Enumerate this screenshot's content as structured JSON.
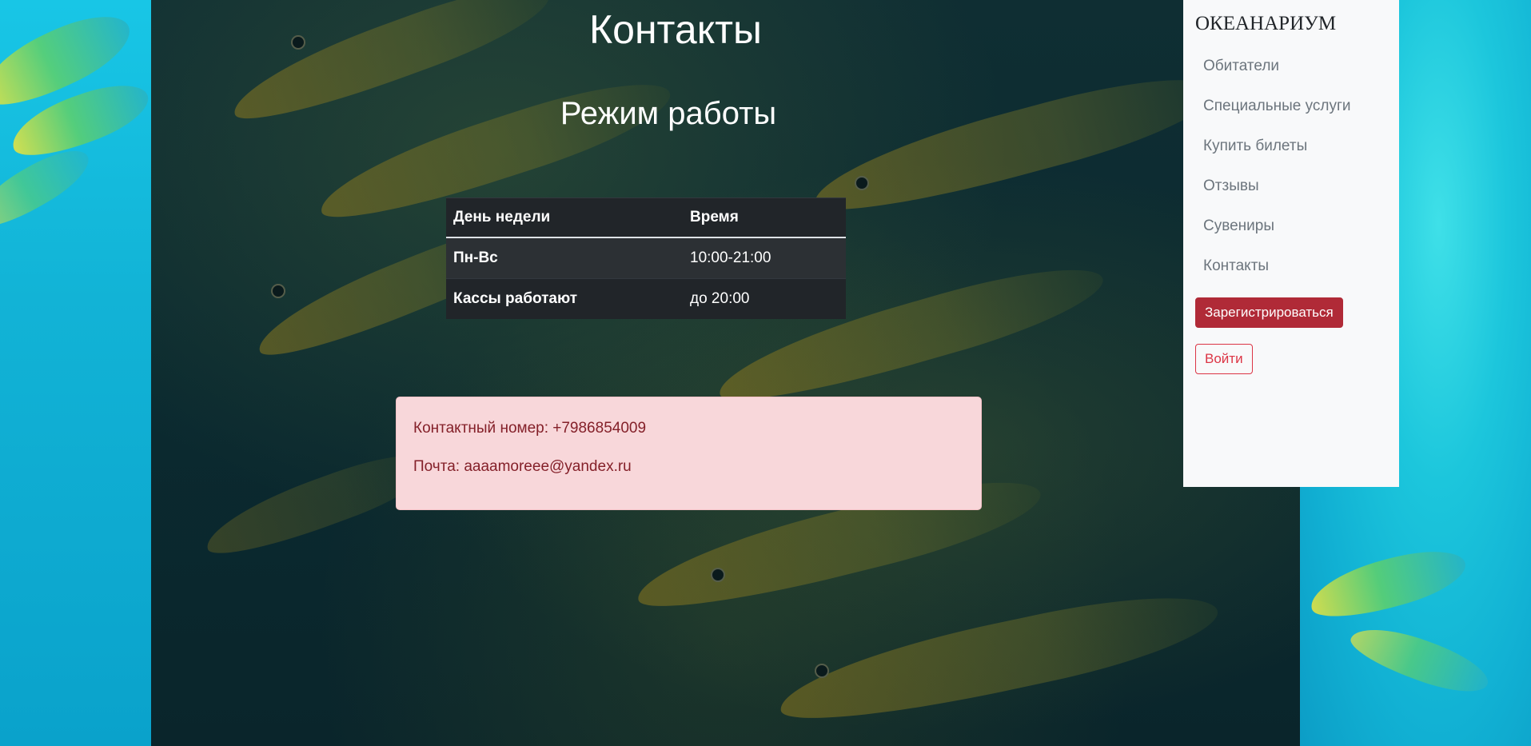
{
  "header": {
    "title": "Контакты",
    "section_title": "Режим работы"
  },
  "schedule": {
    "columns": [
      "День недели",
      "Время"
    ],
    "rows": [
      {
        "day": "Пн-Вс",
        "time": "10:00-21:00"
      },
      {
        "day": "Кассы работают",
        "time": "до 20:00"
      }
    ]
  },
  "contact": {
    "phone": "Контактный номер: +7986854009",
    "email": "Почта: aaaamoreee@yandex.ru",
    "colors": {
      "background": "#f8d7da",
      "text": "#842029"
    }
  },
  "sidebar": {
    "brand": "ОКЕАНАРИУМ",
    "items": [
      {
        "label": "Обитатели"
      },
      {
        "label": "Специальные услуги"
      },
      {
        "label": "Купить билеты"
      },
      {
        "label": "Отзывы"
      },
      {
        "label": "Сувениры"
      },
      {
        "label": "Контакты"
      }
    ],
    "register_label": "Зарегистрироваться",
    "login_label": "Войти"
  },
  "colors": {
    "accent_danger": "#dc3545",
    "register_bg": "#b02a37",
    "table_dark": "#212529",
    "sidebar_bg": "#f8f9fa"
  }
}
